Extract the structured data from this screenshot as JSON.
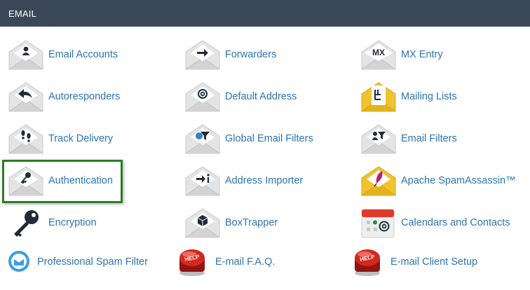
{
  "section": {
    "title": "EMAIL"
  },
  "items": [
    {
      "label": "Email Accounts",
      "icon": "email-accounts-icon"
    },
    {
      "label": "Forwarders",
      "icon": "forwarders-icon"
    },
    {
      "label": "MX Entry",
      "icon": "mx-entry-icon"
    },
    {
      "label": "Autoresponders",
      "icon": "autoresponders-icon"
    },
    {
      "label": "Default Address",
      "icon": "default-address-icon"
    },
    {
      "label": "Mailing Lists",
      "icon": "mailing-lists-icon"
    },
    {
      "label": "Track Delivery",
      "icon": "track-delivery-icon"
    },
    {
      "label": "Global Email Filters",
      "icon": "global-email-filters-icon"
    },
    {
      "label": "Email Filters",
      "icon": "email-filters-icon"
    },
    {
      "label": "Authentication",
      "icon": "authentication-icon"
    },
    {
      "label": "Address Importer",
      "icon": "address-importer-icon"
    },
    {
      "label": "Apache SpamAssassin™",
      "icon": "spamassassin-icon"
    },
    {
      "label": "Encryption",
      "icon": "encryption-key-icon"
    },
    {
      "label": "BoxTrapper",
      "icon": "boxtrapper-icon"
    },
    {
      "label": "Calendars and Contacts",
      "icon": "calendars-contacts-icon"
    },
    {
      "label": "Professional Spam Filter",
      "icon": "professional-spam-filter-icon"
    },
    {
      "label": "E-mail F.A.Q.",
      "icon": "help-button-icon",
      "icon_text": "HELP"
    },
    {
      "label": "E-mail Client Setup",
      "icon": "help-button-icon",
      "icon_text": "HELP"
    }
  ],
  "colors": {
    "header_bg": "#3a4756",
    "link": "#2c74b3",
    "highlight_border": "#2b7d23",
    "envelope": "#e4e4e4",
    "envelope_yellow": "#f0c22e",
    "help_red": "#c8231b"
  },
  "mx_text": "MX"
}
